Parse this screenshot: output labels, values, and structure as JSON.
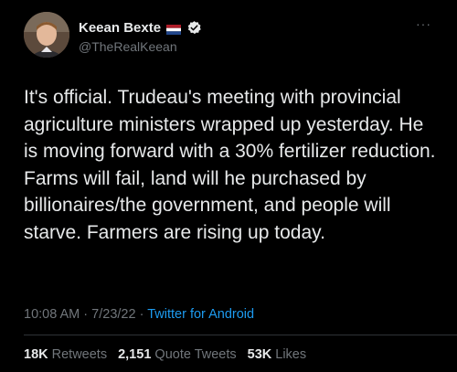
{
  "user": {
    "display_name": "Keean Bexte",
    "handle": "@TheRealKeean",
    "flag_icon": "netherlands-flag-icon",
    "verified_icon": "verified-badge-icon"
  },
  "tweet": {
    "text": "It's official. Trudeau's meeting with provincial agriculture ministers wrapped up yesterday. He is moving forward with a 30% fertilizer reduction. Farms will fail, land will he purchased by billionaires/the government, and people will starve. Farmers are rising up today.",
    "time": "10:08 AM",
    "date": "7/23/22",
    "separator": "·",
    "source": "Twitter for Android"
  },
  "stats": {
    "retweets_count": "18K",
    "retweets_label": "Retweets",
    "quote_count": "2,151",
    "quote_label": "Quote Tweets",
    "likes_count": "53K",
    "likes_label": "Likes"
  },
  "more_label": "···",
  "colors": {
    "background": "#000000",
    "text": "#e7e9ea",
    "secondary": "#71767b",
    "accent": "#1d9bf0",
    "divider": "#2f3336"
  }
}
